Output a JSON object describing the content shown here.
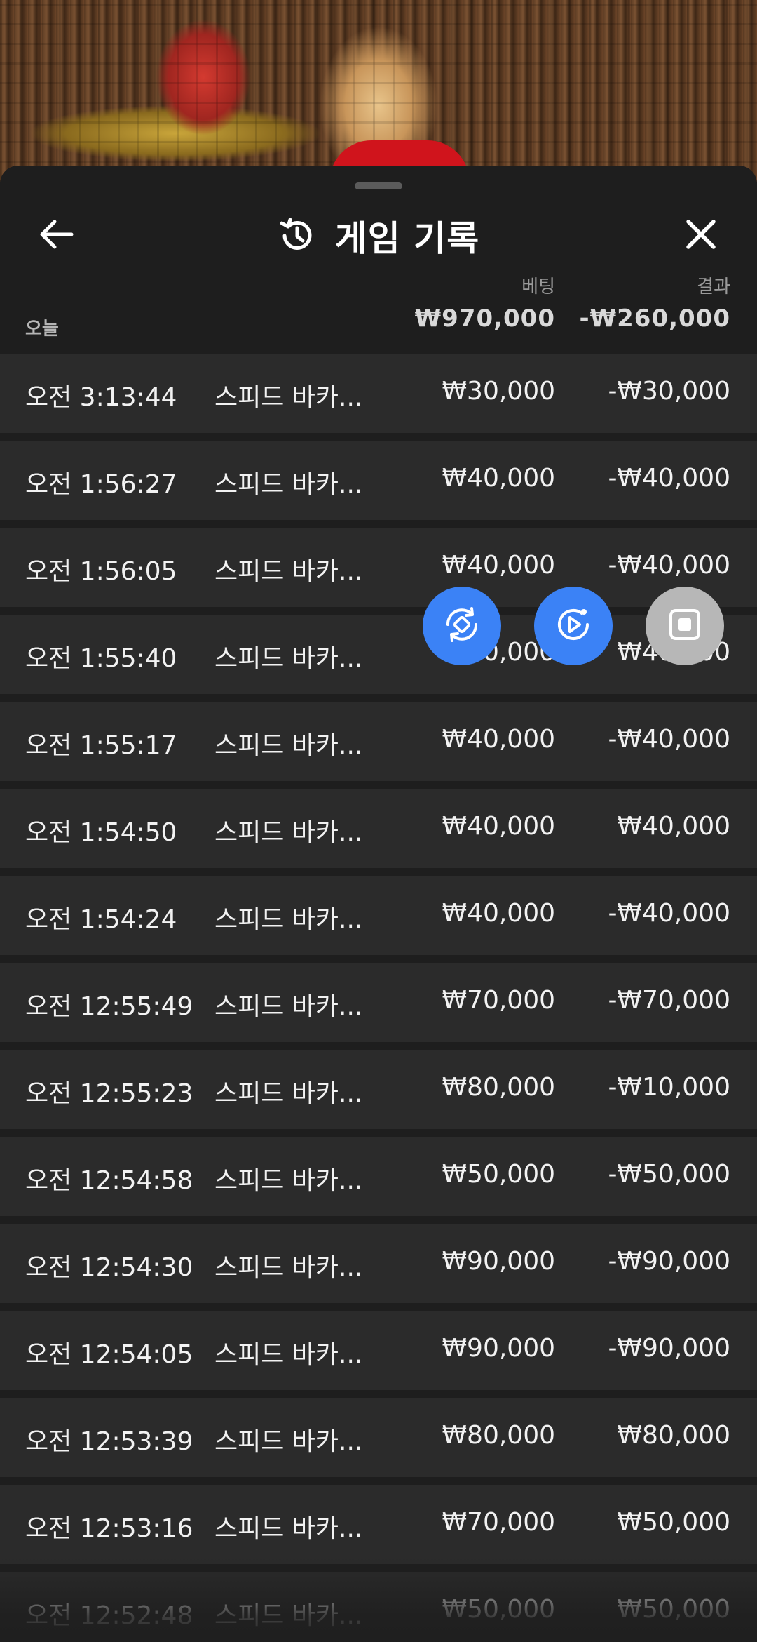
{
  "header": {
    "title": "게임 기록",
    "back_icon": "arrow-left-icon",
    "history_icon": "history-icon",
    "close_icon": "close-icon"
  },
  "summary": {
    "bet_label": "베팅",
    "result_label": "결과",
    "date_label": "오늘",
    "total_bet": "₩970,000",
    "total_result": "-₩260,000"
  },
  "rows": [
    {
      "time": "오전 3:13:44",
      "game": "스피드 바카...",
      "bet": "₩30,000",
      "result": "-₩30,000"
    },
    {
      "time": "오전 1:56:27",
      "game": "스피드 바카...",
      "bet": "₩40,000",
      "result": "-₩40,000"
    },
    {
      "time": "오전 1:56:05",
      "game": "스피드 바카...",
      "bet": "₩40,000",
      "result": "-₩40,000"
    },
    {
      "time": "오전 1:55:40",
      "game": "스피드 바카...",
      "bet": "₩40,000",
      "result": "₩40,000"
    },
    {
      "time": "오전 1:55:17",
      "game": "스피드 바카...",
      "bet": "₩40,000",
      "result": "-₩40,000"
    },
    {
      "time": "오전 1:54:50",
      "game": "스피드 바카...",
      "bet": "₩40,000",
      "result": "₩40,000"
    },
    {
      "time": "오전 1:54:24",
      "game": "스피드 바카...",
      "bet": "₩40,000",
      "result": "-₩40,000"
    },
    {
      "time": "오전 12:55:49",
      "game": "스피드 바카...",
      "bet": "₩70,000",
      "result": "-₩70,000"
    },
    {
      "time": "오전 12:55:23",
      "game": "스피드 바카...",
      "bet": "₩80,000",
      "result": "-₩10,000"
    },
    {
      "time": "오전 12:54:58",
      "game": "스피드 바카...",
      "bet": "₩50,000",
      "result": "-₩50,000"
    },
    {
      "time": "오전 12:54:30",
      "game": "스피드 바카...",
      "bet": "₩90,000",
      "result": "-₩90,000"
    },
    {
      "time": "오전 12:54:05",
      "game": "스피드 바카...",
      "bet": "₩90,000",
      "result": "-₩90,000"
    },
    {
      "time": "오전 12:53:39",
      "game": "스피드 바카...",
      "bet": "₩80,000",
      "result": "₩80,000"
    },
    {
      "time": "오전 12:53:16",
      "game": "스피드 바카...",
      "bet": "₩70,000",
      "result": "₩50,000"
    },
    {
      "time": "오전 12:52:48",
      "game": "스피드 바카...",
      "bet": "₩50,000",
      "result": "₩50,000"
    }
  ],
  "floating_buttons": {
    "rotate_icon": "rotate-screen-icon",
    "replay_icon": "replay-icon",
    "stop_icon": "stop-icon"
  },
  "colors": {
    "accent": "#3b82f6",
    "sheet_bg": "#1e1e1e",
    "row_bg": "#2b2b2b"
  }
}
